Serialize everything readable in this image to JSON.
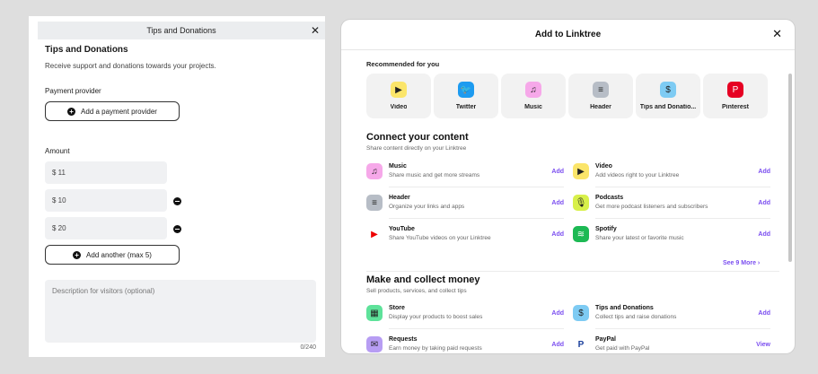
{
  "left_panel": {
    "header_title": "Tips and Donations",
    "close_symbol": "✕",
    "title": "Tips and Donations",
    "description": "Receive support and donations towards your projects.",
    "payment_provider_label": "Payment provider",
    "add_provider_button": "Add a payment provider",
    "amount_label": "Amount",
    "amounts": [
      "$ 11",
      "$ 10",
      "$ 20"
    ],
    "add_another_button": "Add another (max 5)",
    "description_placeholder": "Description for visitors (optional)",
    "char_count": "0/240"
  },
  "modal": {
    "title": "Add to Linktree",
    "close_symbol": "✕",
    "recommended_heading": "Recommended for you",
    "recommended": [
      {
        "label": "Video",
        "icon": "video-icon",
        "bg": "#fbe56a",
        "glyph": "▶"
      },
      {
        "label": "Twitter",
        "icon": "twitter-icon",
        "bg": "#1d9bf0",
        "glyph": "🐦"
      },
      {
        "label": "Music",
        "icon": "music-icon",
        "bg": "#f6a8e9",
        "glyph": "♫"
      },
      {
        "label": "Header",
        "icon": "header-icon",
        "bg": "#b7bdc6",
        "glyph": "≡"
      },
      {
        "label": "Tips and Donatio...",
        "icon": "tips-icon",
        "bg": "#7ecbf3",
        "glyph": "$"
      },
      {
        "label": "Pinterest",
        "icon": "pinterest-icon",
        "bg": "#e60023",
        "glyph": "P"
      }
    ],
    "connect": {
      "title": "Connect your content",
      "subtitle": "Share content directly on your Linktree",
      "items": [
        {
          "title": "Music",
          "desc": "Share music and get more streams",
          "action": "Add",
          "icon": "music-icon",
          "bg": "#f6a8e9",
          "glyph": "♫"
        },
        {
          "title": "Video",
          "desc": "Add videos right to your Linktree",
          "action": "Add",
          "icon": "video-icon",
          "bg": "#fbe56a",
          "glyph": "▶"
        },
        {
          "title": "Header",
          "desc": "Organize your links and apps",
          "action": "Add",
          "icon": "header-icon",
          "bg": "#b7bdc6",
          "glyph": "≡"
        },
        {
          "title": "Podcasts",
          "desc": "Get more podcast listeners and subscribers",
          "action": "Add",
          "icon": "podcast-icon",
          "bg": "#d8f04a",
          "glyph": "🎙"
        },
        {
          "title": "YouTube",
          "desc": "Share YouTube videos on your Linktree",
          "action": "Add",
          "icon": "youtube-icon",
          "bg": "#ffffff",
          "glyph": "▶"
        },
        {
          "title": "Spotify",
          "desc": "Share your latest or favorite music",
          "action": "Add",
          "icon": "spotify-icon",
          "bg": "#1db954",
          "glyph": "≋"
        }
      ],
      "see_more": "See 9 More  ›"
    },
    "money": {
      "title": "Make and collect money",
      "subtitle": "Sell products, services, and collect tips",
      "items": [
        {
          "title": "Store",
          "desc": "Display your products to boost sales",
          "action": "Add",
          "icon": "store-icon",
          "bg": "#5ee29a",
          "glyph": "▦"
        },
        {
          "title": "Tips and Donations",
          "desc": "Collect tips and raise donations",
          "action": "Add",
          "icon": "tips-icon",
          "bg": "#7ecbf3",
          "glyph": "$"
        },
        {
          "title": "Requests",
          "desc": "Earn money by taking paid requests",
          "action": "Add",
          "icon": "requests-icon",
          "bg": "#b79df3",
          "glyph": "✉"
        },
        {
          "title": "PayPal",
          "desc": "Get paid with PayPal",
          "action": "View",
          "icon": "paypal-icon",
          "bg": "#ffffff",
          "glyph": "P"
        }
      ]
    }
  }
}
